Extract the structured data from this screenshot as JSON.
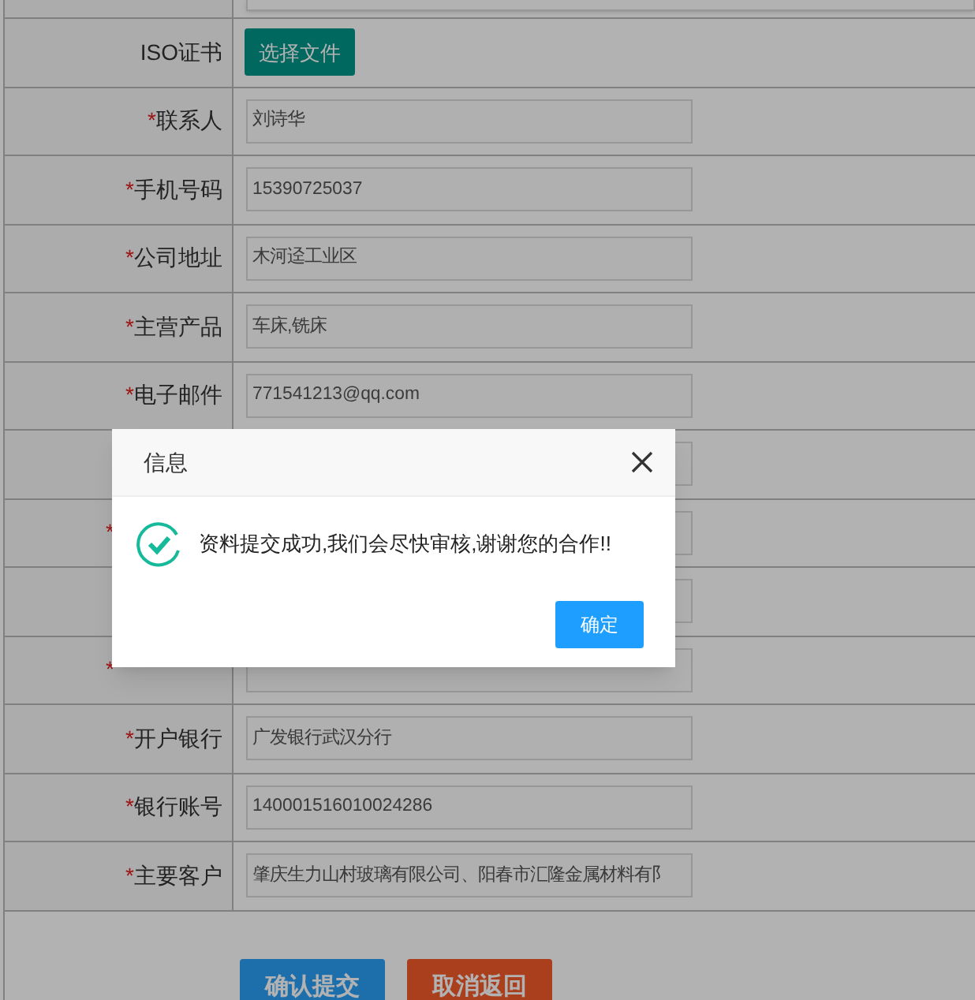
{
  "file_row": {
    "label": "ISO证书",
    "button": "选择文件"
  },
  "rows": [
    {
      "kind": "labeled",
      "mark": "*",
      "label": "联系人",
      "value": "刘诗华"
    },
    {
      "kind": "labeled",
      "mark": "*",
      "label": "手机号码",
      "value": "15390725037"
    },
    {
      "kind": "labeled",
      "mark": "*",
      "label": "公司地址",
      "value": "木河迳工业区"
    },
    {
      "kind": "labeled",
      "mark": "*",
      "label": "主营产品",
      "value": "车床,铣床"
    },
    {
      "kind": "labeled",
      "mark": "*",
      "label": "电子邮件",
      "value": "771541213@qq.com"
    },
    {
      "kind": "obscured"
    },
    {
      "kind": "obscured",
      "mark": "*"
    },
    {
      "kind": "obscured"
    },
    {
      "kind": "obscured",
      "mark": "*"
    },
    {
      "kind": "labeled",
      "mark": "*",
      "label": "开户银行",
      "value": "广发银行武汉分行"
    },
    {
      "kind": "labeled",
      "mark": "*",
      "label": "银行账号",
      "value": "140001516010024286"
    },
    {
      "kind": "labeled",
      "mark": "*",
      "label": "主要客户",
      "value": "肇庆生力山村玻璃有限公司、阳春市汇隆金属材料有阝"
    }
  ],
  "buttons": [
    {
      "label": "确认提交",
      "kind": "submit"
    },
    {
      "label": "取消返回",
      "kind": "cancel"
    }
  ],
  "dialog": {
    "title": "信息",
    "message": "资料提交成功,我们会尽快审核,谢谢您的合作!!",
    "ok": "确定"
  }
}
